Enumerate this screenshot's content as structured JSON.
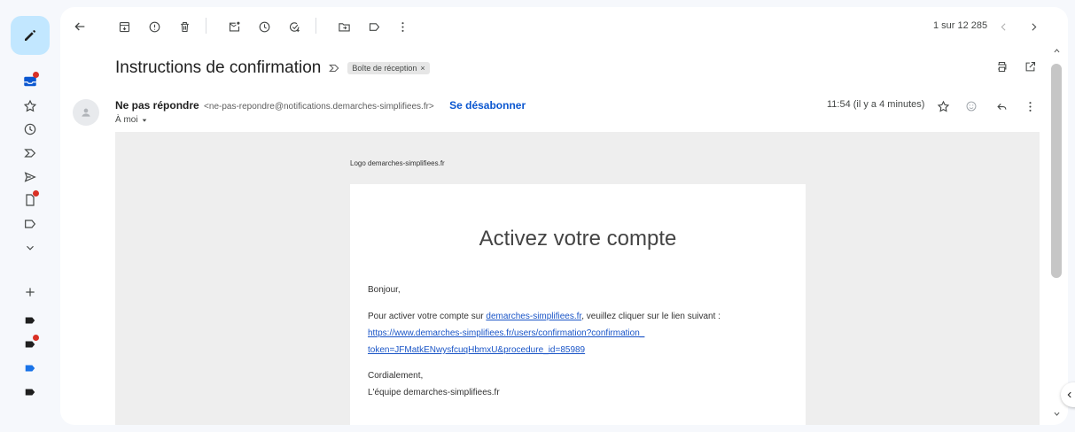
{
  "toolbar": {
    "pager": "1 sur 12 285"
  },
  "email": {
    "subject": "Instructions de confirmation",
    "label_chip": "Boîte de réception",
    "label_chip_close": "×",
    "sender_name": "Ne pas répondre",
    "sender_email": "<ne-pas-repondre@notifications.demarches-simplifiees.fr>",
    "unsubscribe": "Se désabonner",
    "to": "À moi",
    "time": "11:54 (il y a 4 minutes)"
  },
  "body": {
    "logo_alt": "Logo demarches-simplifiees.fr",
    "title": "Activez votre compte",
    "greeting": "Bonjour,",
    "intro_before": "Pour activer votre compte sur ",
    "intro_link": "demarches-simplifiees.fr",
    "intro_after": ", veuillez cliquer sur le lien suivant :",
    "link_line1": "https://www.demarches-simplifiees.fr/users/confirmation?confirmation_",
    "link_line2": "token=JFMatkENwysfcuqHbmxU&procedure_id=85989",
    "signoff": "Cordialement,",
    "team": "L'équipe demarches-simplifiees.fr"
  },
  "colors": {
    "accent": "#0b57d0",
    "compose_bg": "#c2e7ff",
    "notification_dot": "#d93025",
    "label_blue": "#1a73e8"
  }
}
